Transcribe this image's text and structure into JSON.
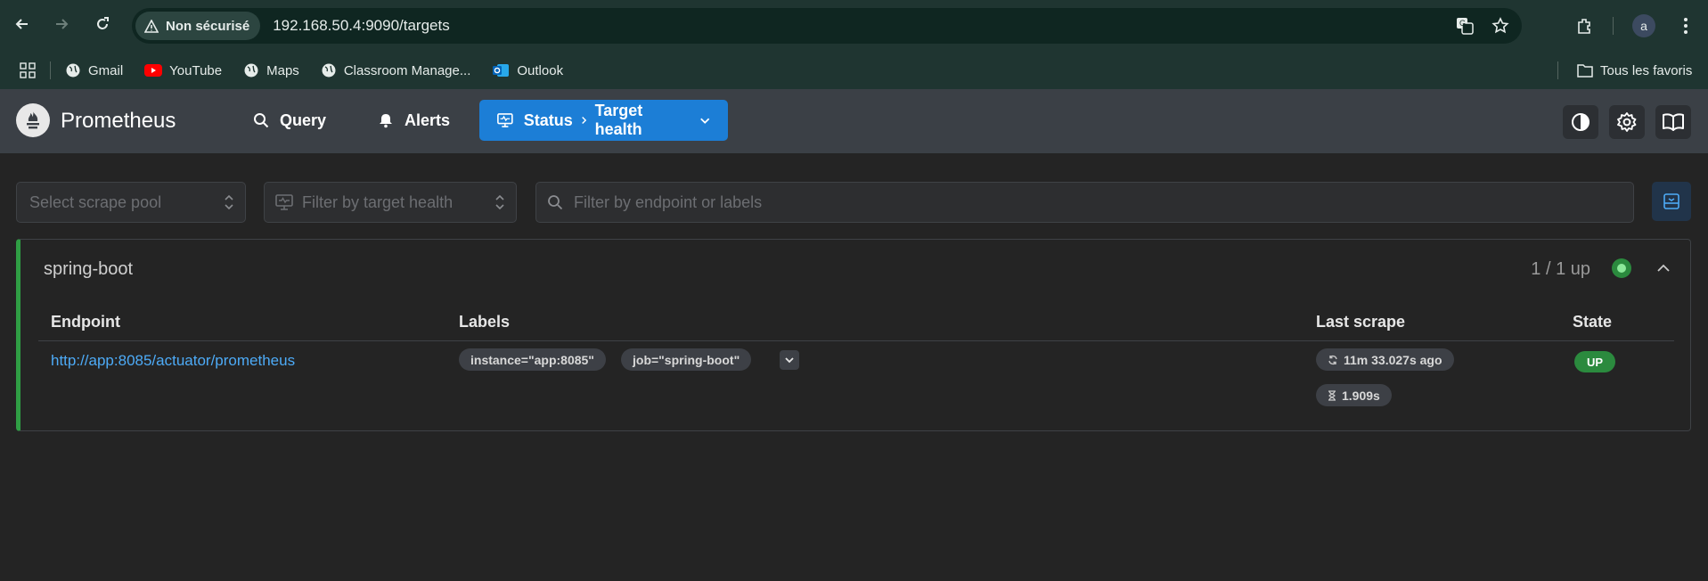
{
  "browser": {
    "security_label": "Non sécurisé",
    "url": "192.168.50.4:9090/targets",
    "avatar_letter": "a",
    "bookmarks": [
      "Gmail",
      "YouTube",
      "Maps",
      "Classroom Manage...",
      "Outlook"
    ],
    "all_bookmarks": "Tous les favoris"
  },
  "app": {
    "name": "Prometheus",
    "nav": {
      "query": "Query",
      "alerts": "Alerts",
      "status": "Status",
      "status_sub": "Target health"
    }
  },
  "filters": {
    "scrape_pool": "Select scrape pool",
    "target_health": "Filter by target health",
    "endpoint": "Filter by endpoint or labels"
  },
  "pool": {
    "name": "spring-boot",
    "count": "1 / 1 up",
    "status_color": "#2f9e44",
    "columns": {
      "endpoint": "Endpoint",
      "labels": "Labels",
      "last_scrape": "Last scrape",
      "state": "State"
    },
    "targets": [
      {
        "endpoint": "http://app:8085/actuator/prometheus",
        "labels": [
          "instance=\"app:8085\"",
          "job=\"spring-boot\""
        ],
        "last_scrape": "11m 33.027s ago",
        "duration": "1.909s",
        "state": "UP"
      }
    ]
  },
  "colors": {
    "accent": "#1c7ed6",
    "up": "#2b8a3e",
    "link": "#4dabf7"
  }
}
